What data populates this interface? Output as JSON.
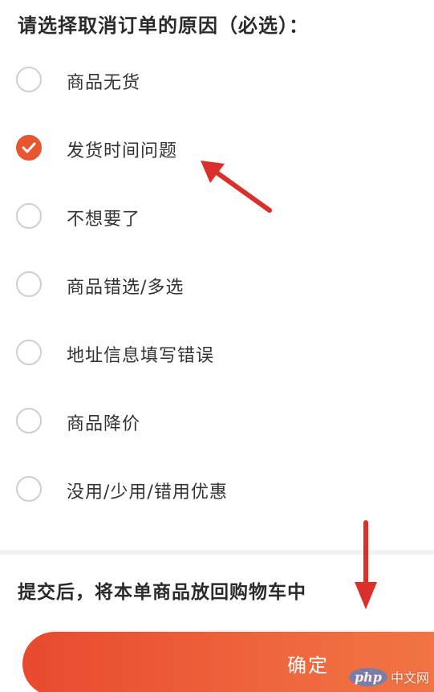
{
  "header": {
    "title": "请选择取消订单的原因（必选）："
  },
  "reasons": [
    {
      "label": "商品无货",
      "checked": false
    },
    {
      "label": "发货时间问题",
      "checked": true
    },
    {
      "label": "不想要了",
      "checked": false
    },
    {
      "label": "商品错选/多选",
      "checked": false
    },
    {
      "label": "地址信息填写错误",
      "checked": false
    },
    {
      "label": "商品降价",
      "checked": false
    },
    {
      "label": "没用/少用/错用优惠",
      "checked": false
    }
  ],
  "footer": {
    "notice": "提交后，将本单商品放回购物车中",
    "confirm_label": "确定"
  },
  "watermark": {
    "logo_text": "php",
    "site_text": "中文网"
  },
  "colors": {
    "accent": "#e8562f",
    "annotation_arrow": "#d9302b",
    "radio_border": "#cfcfcf"
  }
}
